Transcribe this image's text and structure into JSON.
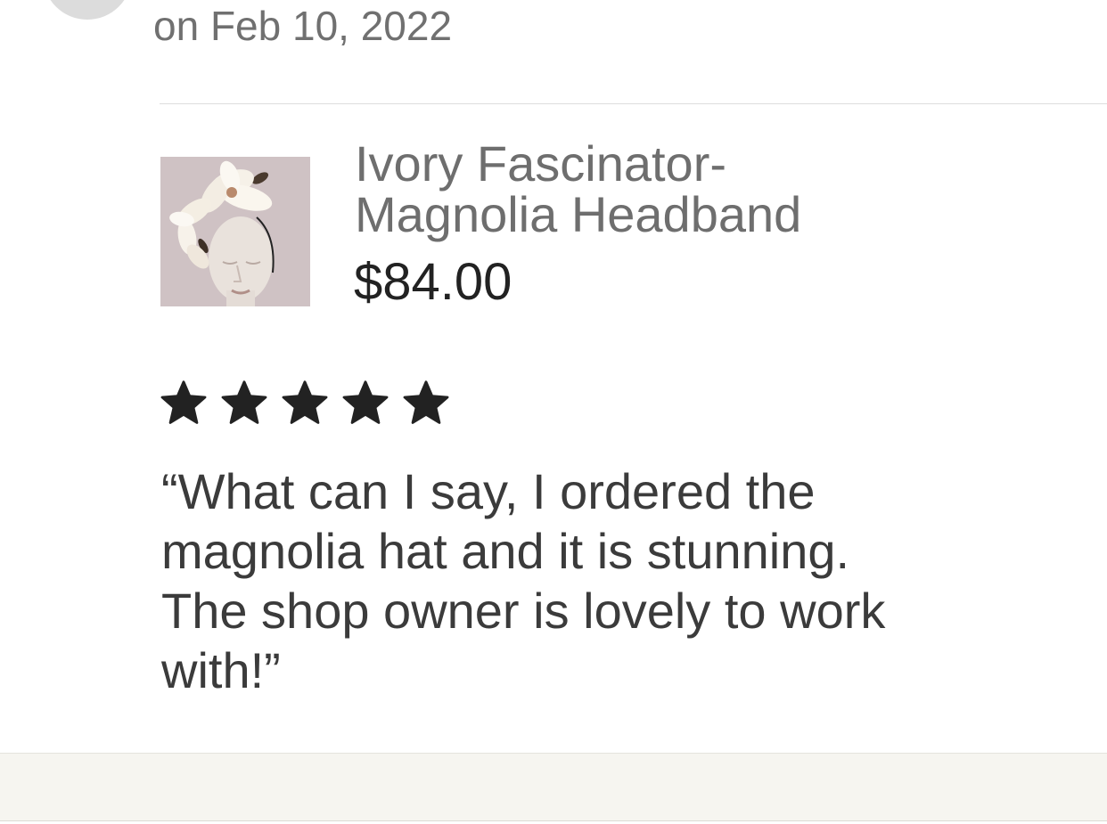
{
  "review": {
    "date": "on Feb 10, 2022",
    "rating": 5,
    "rating_max": 5,
    "text_lines": [
      "“What can I say, I ordered the",
      "magnolia hat and it is stunning.",
      "The shop owner is lovely to work",
      "with!”"
    ]
  },
  "item": {
    "title_lines": [
      "Ivory Fascinator-",
      "Magnolia Headband"
    ],
    "price": "$84.00",
    "thumbnail_icon": "fascinator-product-photo"
  },
  "colors": {
    "star": "#222222",
    "title": "#6e6e6e",
    "review_text": "#3b3b3b",
    "footer_band": "#f6f5f0"
  }
}
